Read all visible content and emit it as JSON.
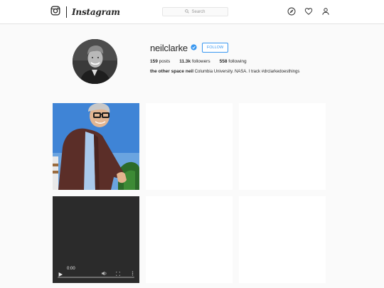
{
  "header": {
    "brand": "Instagram",
    "search_placeholder": "Search"
  },
  "profile": {
    "username": "neilclarke",
    "verified": true,
    "follow_label": "FOLLOW",
    "stats": {
      "posts_count": "159",
      "posts_label": "posts",
      "followers_count": "11.3k",
      "followers_label": "followers",
      "following_count": "558",
      "following_label": "following"
    },
    "bio": {
      "full_name": "the other space neil",
      "text": "Columbia University. NASA. I track #drclarkedoesthings"
    }
  },
  "video": {
    "time": "0:00",
    "progress": 0
  },
  "colors": {
    "accent": "#3897f0",
    "text": "#262626",
    "background": "#fafafa"
  },
  "icons": [
    "instagram-camera-icon",
    "search-icon",
    "compass-icon",
    "heart-icon",
    "user-icon",
    "verified-badge-icon",
    "play-icon",
    "volume-icon",
    "fullscreen-icon",
    "more-icon"
  ]
}
